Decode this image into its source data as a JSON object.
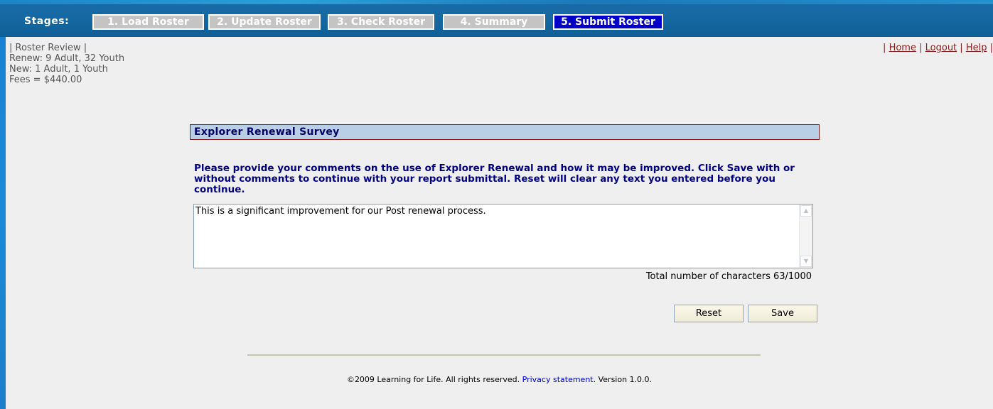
{
  "header": {
    "stages_label": "Stages:",
    "stages": [
      {
        "label": "1. Load Roster",
        "active": false
      },
      {
        "label": "2. Update Roster",
        "active": false
      },
      {
        "label": "3. Check Roster",
        "active": false
      },
      {
        "label": "4. Summary",
        "active": false
      },
      {
        "label": "5. Submit Roster",
        "active": true
      }
    ]
  },
  "info": {
    "roster_review": "| Roster Review |",
    "renew": "Renew: 9 Adult, 32 Youth",
    "new": "New: 1 Adult, 1 Youth",
    "fees": "Fees = $440.00"
  },
  "toplinks": {
    "home": "Home",
    "logout": "Logout",
    "help": "Help",
    "separator": "|"
  },
  "survey": {
    "title": "Explorer Renewal Survey",
    "instructions": "Please provide your comments on the use of Explorer Renewal and how it may be improved. Click Save with or without comments to continue with your report submittal. Reset will clear any text you entered before you continue.",
    "comment": "This is a significant improvement for our Post renewal process.",
    "char_count": "Total number of characters 63/1000",
    "reset_label": "Reset",
    "save_label": "Save"
  },
  "footer": {
    "copyright": "©2009 Learning for Life. All rights reserved.",
    "privacy_link": "Privacy statement",
    "version": ". Version 1.0.0."
  },
  "colors": {
    "header_bg": "#0f5f97",
    "stage_inactive": "#c4c4c4",
    "stage_active": "#0000c8",
    "survey_header_bg": "#b9cfe6",
    "instruction_text": "#000080",
    "link_red": "#8b1c1c"
  }
}
